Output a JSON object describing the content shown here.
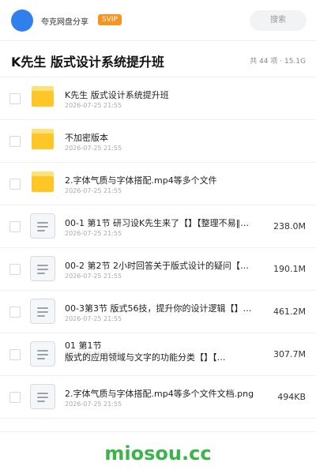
{
  "header": {
    "account_name": "夸克网盘分享",
    "badge": "SVIP",
    "search_label": "搜索"
  },
  "page": {
    "title": "K先生 版式设计系统提升班",
    "meta": "共 44 项 · 15.1G"
  },
  "files": [
    {
      "type": "folder",
      "name": "K先生 版式设计系统提升班",
      "date": "2026-07-25 21:55",
      "size": ""
    },
    {
      "type": "folder",
      "name": "不加密版本",
      "date": "2026-07-25 21:55",
      "size": ""
    },
    {
      "type": "folder",
      "name": "2.字体气质与字体搭配.mp4等多个文件",
      "date": "2026-07-25 21:55",
      "size": ""
    },
    {
      "type": "doc",
      "name": "00-1 第1节 研习设K先生来了【】【整理不易‖…",
      "date": "2026-07-25 21:55",
      "size": "238.0M"
    },
    {
      "type": "doc",
      "name": "00-2 第2节 2小时回答关于版式设计的疑问【】…",
      "date": "2026-07-25 21:55",
      "size": "190.1M"
    },
    {
      "type": "doc",
      "name": "00-3第3节 版式56技，提升你的设计逻辑【】【…",
      "date": "2026-07-25 21:55",
      "size": "461.2M"
    },
    {
      "type": "doc",
      "name_line1": "01 第1节",
      "name_line2": "版式的应用领域与文字的功能分类【】【…",
      "date": "2026-07-25 21:55",
      "size": "307.7M"
    },
    {
      "type": "doc",
      "name": "2.字体气质与字体搭配.mp4等多个文件文档.png",
      "date": "2026-07-25 21:55",
      "size": "494KB"
    }
  ],
  "watermark": "miosou.cc",
  "colors": {
    "avatar": "#2f80ed",
    "badge": "#f7931e",
    "folder": "#ffc627",
    "watermark": "#3ab54a"
  }
}
